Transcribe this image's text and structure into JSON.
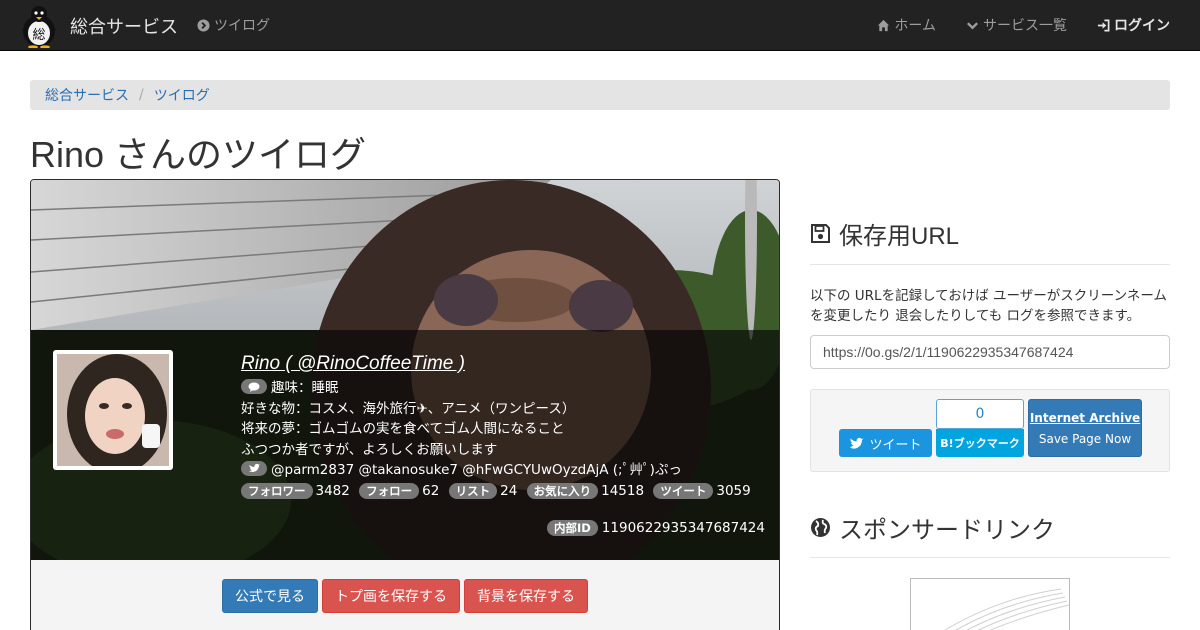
{
  "nav": {
    "brand": "総合サービス",
    "left_item": "ツイログ",
    "right_items": [
      {
        "label": "ホーム",
        "icon": "home-icon"
      },
      {
        "label": "サービス一覧",
        "icon": "chevron-down-icon"
      },
      {
        "label": "ログイン",
        "icon": "sign-in-icon"
      }
    ]
  },
  "breadcrumb": [
    "総合サービス",
    "ツイログ"
  ],
  "page_title": "Rino さんのツイログ",
  "profile": {
    "name": "Rino ( @RinoCoffeeTime )",
    "bio_lines": [
      "趣味：睡眠",
      "好きな物：コスメ、海外旅行✈、アニメ（ワンピース）",
      "将来の夢：ゴムゴムの実を食べてゴム人間になること",
      "ふつつか者ですが、よろしくお願いします"
    ],
    "mentions": "@parm2837 @takanosuke7 @hFwGCYUwOyzdAjA (;ﾟ艸ﾟ)ぷっ",
    "stats": [
      {
        "label": "フォロワー",
        "value": "3482"
      },
      {
        "label": "フォロー",
        "value": "62"
      },
      {
        "label": "リスト",
        "value": "24"
      },
      {
        "label": "お気に入り",
        "value": "14518"
      },
      {
        "label": "ツイート",
        "value": "3059"
      }
    ],
    "internal_id_label": "内部ID",
    "internal_id": "1190622935347687424"
  },
  "actions": {
    "official": "公式で見る",
    "save_avatar": "トプ画を保存する",
    "save_background": "背景を保存する"
  },
  "sidebar": {
    "save_url_heading": "保存用URL",
    "save_url_text": "以下の URLを記録しておけば ユーザーがスクリーンネームを変更したり 退会したりしても ログを参照できます。",
    "save_url_value": "https://0o.gs/2/1/1190622935347687424",
    "tweet_label": "ツイート",
    "hatena_count": "0",
    "hatena_label": "B!ブックマーク",
    "ia_title": "Internet Archive",
    "ia_sub": "Save Page Now",
    "sponsored_heading": "スポンサードリンク"
  },
  "colors": {
    "navbar": "#222222",
    "link": "#2a6fb3",
    "primary": "#337ab7",
    "danger": "#d9534f",
    "twitter": "#1b95e0",
    "hatena": "#00a4de"
  }
}
